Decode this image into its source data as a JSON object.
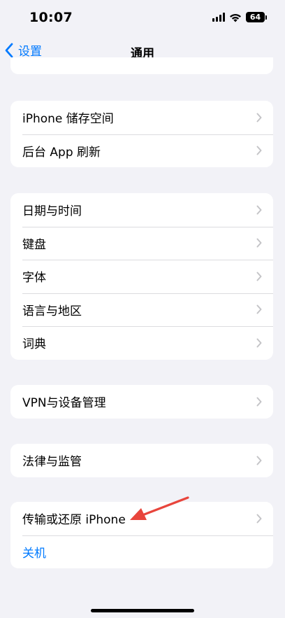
{
  "status_bar": {
    "time": "10:07",
    "battery": "64"
  },
  "nav": {
    "back_label": "设置",
    "title": "通用"
  },
  "groups": [
    {
      "rows": [
        {
          "label": "iPhone 储存空间"
        },
        {
          "label": "后台 App 刷新"
        }
      ]
    },
    {
      "rows": [
        {
          "label": "日期与时间"
        },
        {
          "label": "键盘"
        },
        {
          "label": "字体"
        },
        {
          "label": "语言与地区"
        },
        {
          "label": "词典"
        }
      ]
    },
    {
      "rows": [
        {
          "label": "VPN与设备管理"
        }
      ]
    },
    {
      "rows": [
        {
          "label": "法律与监管"
        }
      ]
    },
    {
      "rows": [
        {
          "label": "传输或还原 iPhone"
        },
        {
          "label": "关机"
        }
      ]
    }
  ],
  "colors": {
    "accent": "#007aff",
    "background": "#f2f2f7",
    "annotation": "#e8453c"
  },
  "icons": [
    "signal-icon",
    "wifi-icon",
    "battery-icon",
    "back-chevron-icon",
    "chevron-right-icon",
    "annotation-arrow"
  ]
}
